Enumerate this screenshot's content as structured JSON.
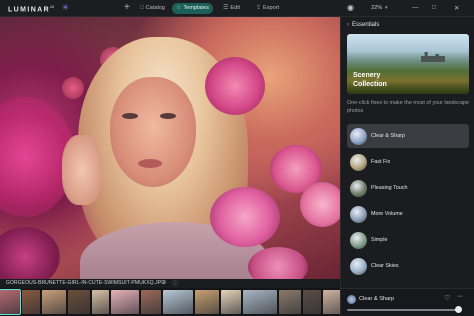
{
  "app": {
    "logo": "LUMINAR",
    "logo_sup": "AI"
  },
  "topbar": {
    "add_icon": "plus-icon",
    "tabs": [
      {
        "label": "Catalog",
        "icon": "catalog-icon",
        "active": false
      },
      {
        "label": "Templates",
        "icon": "templates-icon",
        "active": true
      },
      {
        "label": "Edit",
        "icon": "edit-icon",
        "active": false
      },
      {
        "label": "Export",
        "icon": "export-icon",
        "active": false
      }
    ],
    "zoom": "22%"
  },
  "canvas": {
    "image": "portrait-blonde-woman-pink-roses"
  },
  "filmstrip": {
    "filename": "GORGEOUS-BRUNETTE-GIRL-IN-CUTE-SWIMSUIT-PMUKXQ.JPG",
    "thumb_colors": [
      "#b56a72",
      "#8a5a3f",
      "#c9a07a",
      "#6a4f3a",
      "#d9c0a5",
      "#e8b2b9",
      "#9b6a5a",
      "#b8c9d6",
      "#c7a173",
      "#e6d3b9",
      "#a9b8c4",
      "#8c7a6a",
      "#5b4d45",
      "#d0b3a0",
      "#c4d2db",
      "#7a5c4f"
    ],
    "selected_index": 0
  },
  "panel": {
    "title": "Essentials",
    "hero_line1": "Scenery",
    "hero_line2": "Collection",
    "description": "One-click fixes to make the most of your landscape photos",
    "templates": [
      {
        "label": "Clear & Sharp",
        "active": true,
        "icon_color": "#8fa6c4"
      },
      {
        "label": "Fast Fix",
        "active": false,
        "icon_color": "#b5a37c"
      },
      {
        "label": "Pleasing Touch",
        "active": false,
        "icon_color": "#6f7f6a"
      },
      {
        "label": "More Volume",
        "active": false,
        "icon_color": "#8b9db3"
      },
      {
        "label": "Simple",
        "active": false,
        "icon_color": "#7e9c88"
      },
      {
        "label": "Clear Skies",
        "active": false,
        "icon_color": "#9ab0c5"
      }
    ],
    "bottom": {
      "label": "Clear & Sharp",
      "slider_fraction": 1.0
    }
  }
}
